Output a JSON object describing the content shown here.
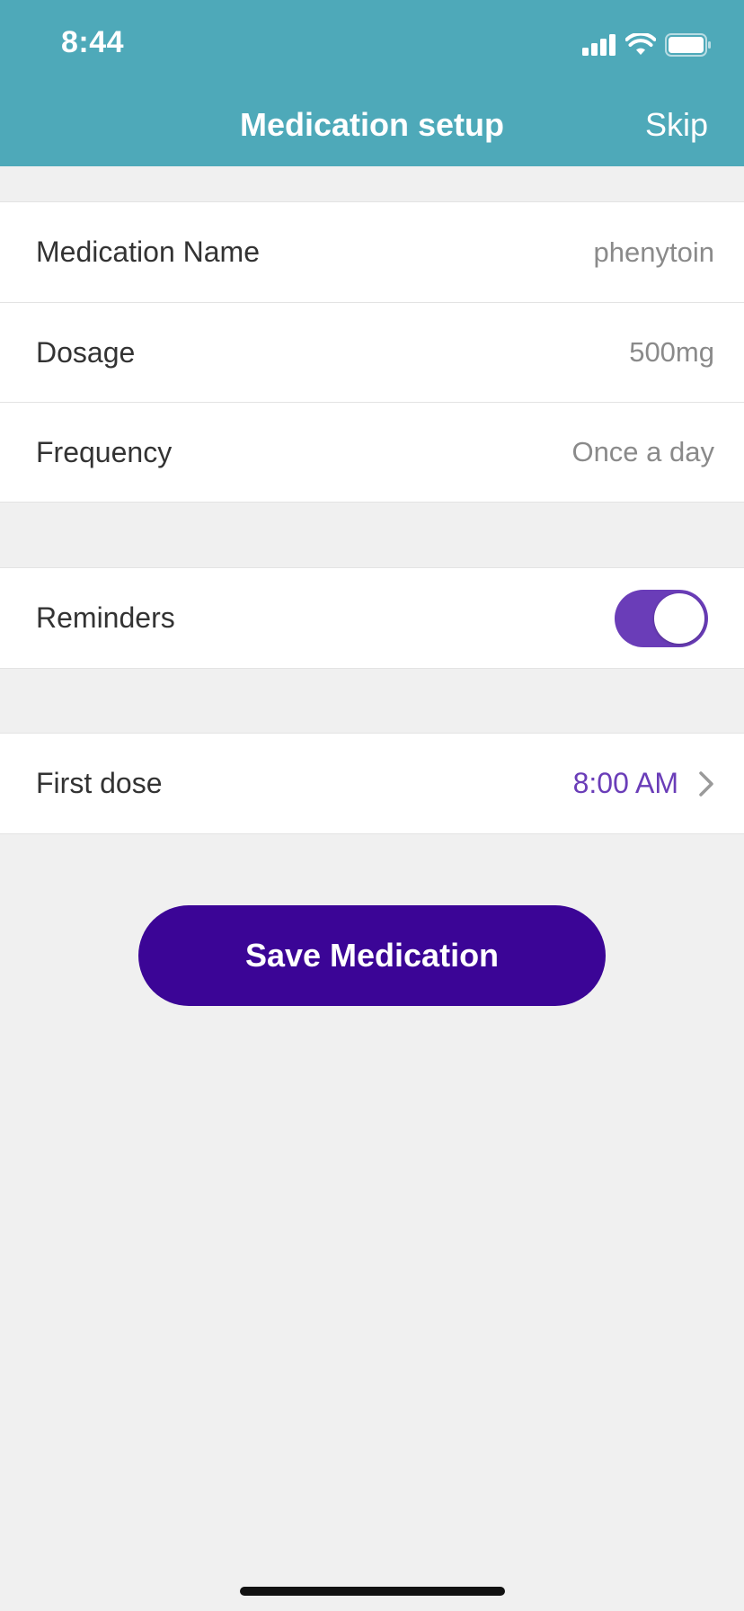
{
  "status_bar": {
    "time": "8:44",
    "icons": [
      "signal-icon",
      "wifi-icon",
      "battery-icon"
    ]
  },
  "nav": {
    "title": "Medication setup",
    "skip_label": "Skip"
  },
  "medication": {
    "name_label": "Medication Name",
    "name_value": "phenytoin",
    "dosage_label": "Dosage",
    "dosage_value": "500mg",
    "frequency_label": "Frequency",
    "frequency_value": "Once a day"
  },
  "reminders": {
    "label": "Reminders",
    "enabled": true
  },
  "first_dose": {
    "label": "First dose",
    "value": "8:00 AM"
  },
  "save_label": "Save Medication",
  "colors": {
    "header": "#4ea9b9",
    "accent": "#6a3db8",
    "button": "#3b0596",
    "background": "#f0f0f0"
  }
}
